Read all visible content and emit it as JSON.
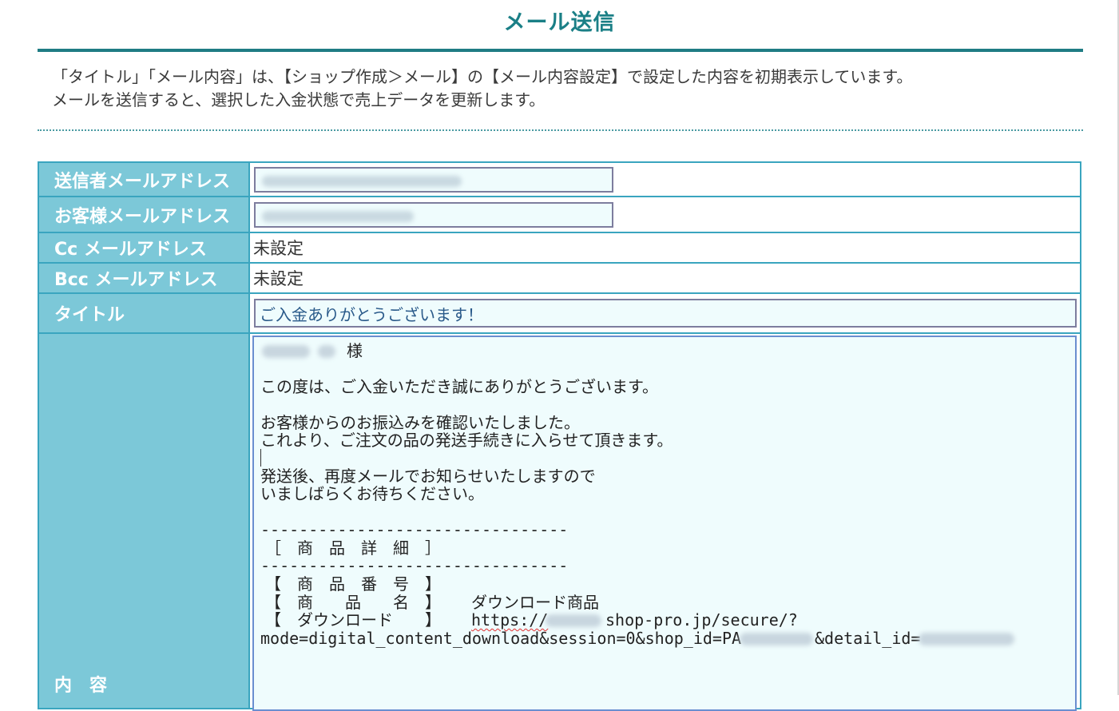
{
  "page": {
    "title": "メール送信",
    "note_lines": [
      "「タイトル」「メール内容」は、【ショップ作成＞メール】の【メール内容設定】で設定した内容を初期表示しています。",
      "メールを送信すると、選択した入金状態で売上データを更新します。"
    ]
  },
  "form": {
    "sender_label": "送信者メールアドレス",
    "customer_label": "お客様メールアドレス",
    "cc_label": "Cc メールアドレス",
    "cc_value": "未設定",
    "bcc_label": "Bcc メールアドレス",
    "bcc_value": "未設定",
    "title_label": "タイトル",
    "title_value": "ご入金ありがとうございます！",
    "content_label": "内　容",
    "body": {
      "salutation": "様",
      "line1": "この度は、ご入金いただき誠にありがとうございます。",
      "line2": "お客様からのお振込みを確認いたしました。",
      "line3": "これより、ご注文の品の発送手続きに入らせて頂きます。",
      "line4": "発送後、再度メールでお知らせいたしますので",
      "line5": "いましばらくお待ちください。",
      "separator": "--------------------------------",
      "section_header": "［　商　品　詳　細　］",
      "item_number_label": "【　商　品　番　号　】",
      "item_name_label": "【　商　　品　　名　】",
      "item_name_value": "ダウンロード商品",
      "download_label": "【　ダウンロード　　】",
      "download_url_prefix": "https://",
      "download_url_host": "shop-pro.jp/secure/?",
      "download_url_query": "mode=digital_content_download&session=0&shop_id=PA",
      "download_url_detail": "&detail_id="
    }
  },
  "colors": {
    "accent": "#1a7f86",
    "label_bg": "#7cc8d8",
    "border": "#3aa5bf",
    "input_bg": "#effcfd"
  }
}
